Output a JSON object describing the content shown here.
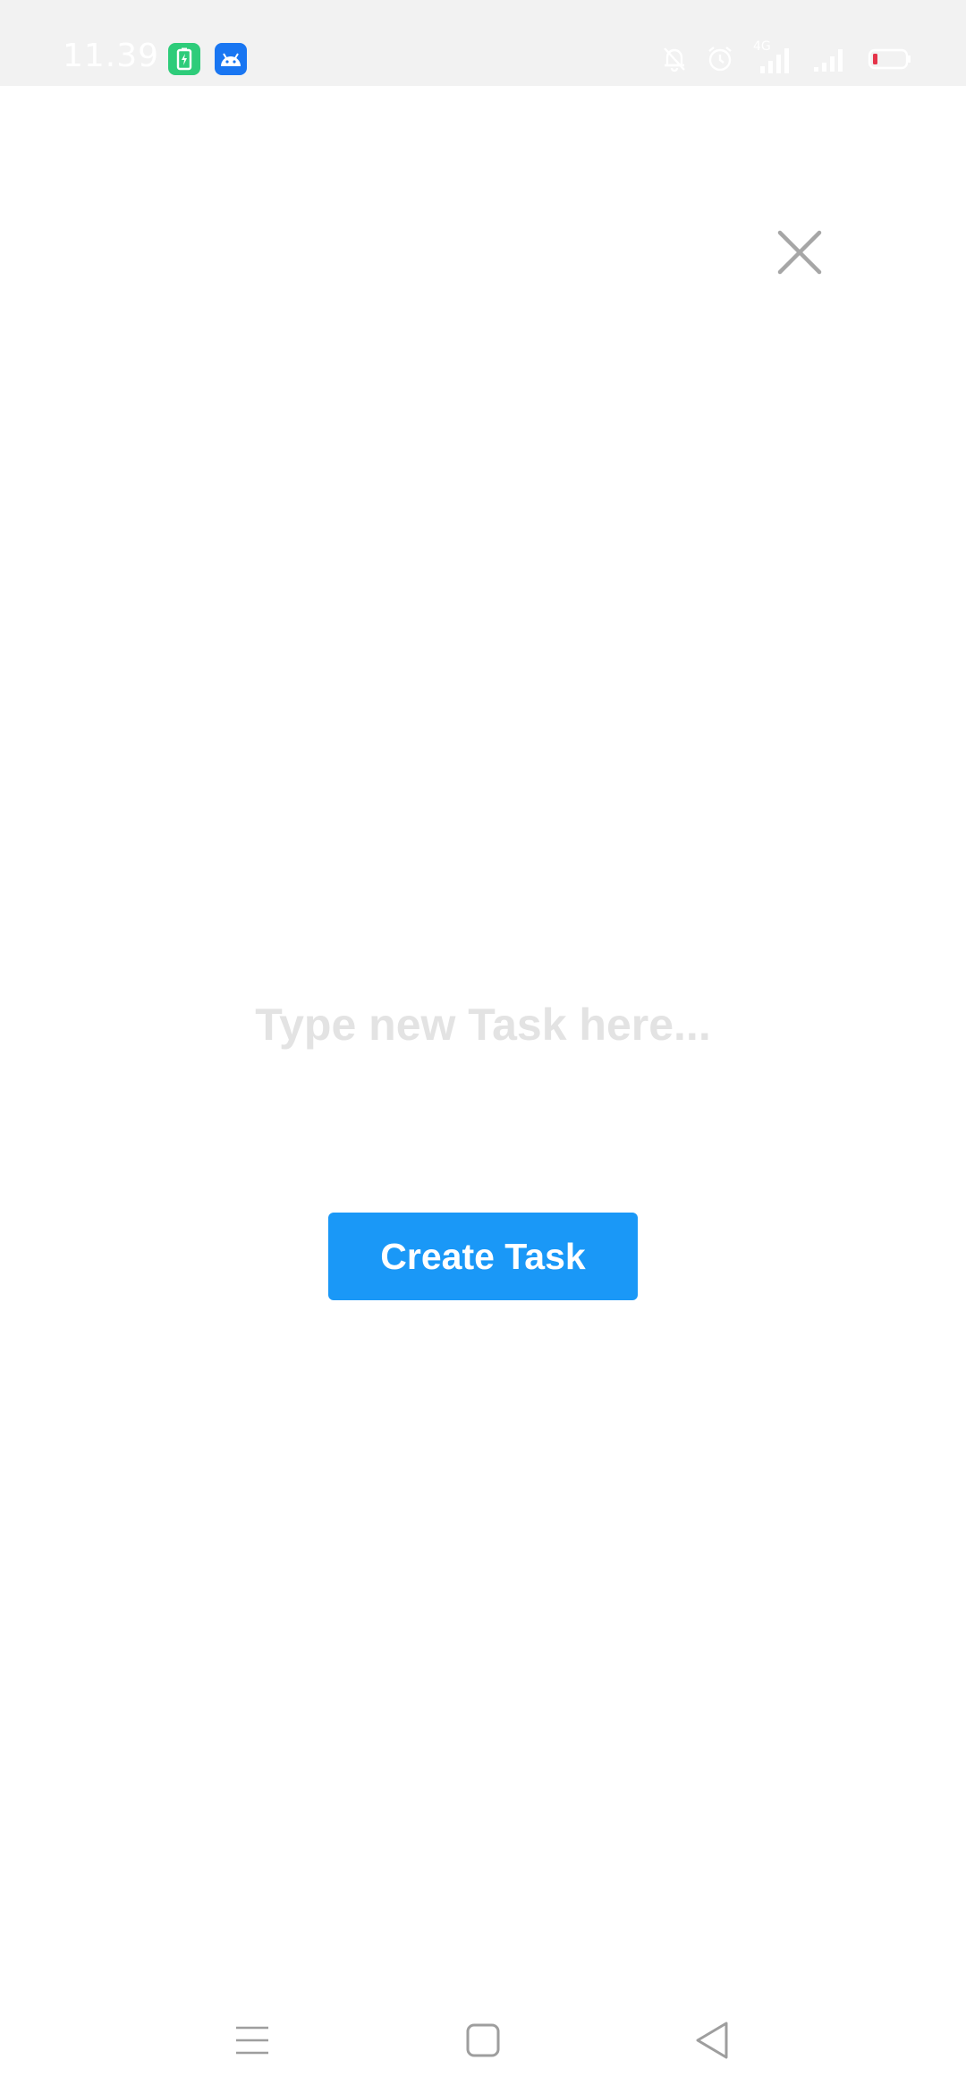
{
  "status_bar": {
    "time": "11.39",
    "network_label": "4G",
    "icons": [
      "battery-saver-icon",
      "android-icon",
      "mute-bell-icon",
      "alarm-icon",
      "signal-4g-icon",
      "signal-icon",
      "battery-icon"
    ],
    "battery_level_color": "#e5344a"
  },
  "dialog": {
    "close_icon": "close-icon",
    "task_input": {
      "value": "",
      "placeholder": "Type new Task here..."
    },
    "create_button_label": "Create Task",
    "accent_color": "#1a98f7"
  },
  "nav_bar": {
    "icons": [
      "menu-icon",
      "home-icon",
      "back-icon"
    ]
  }
}
